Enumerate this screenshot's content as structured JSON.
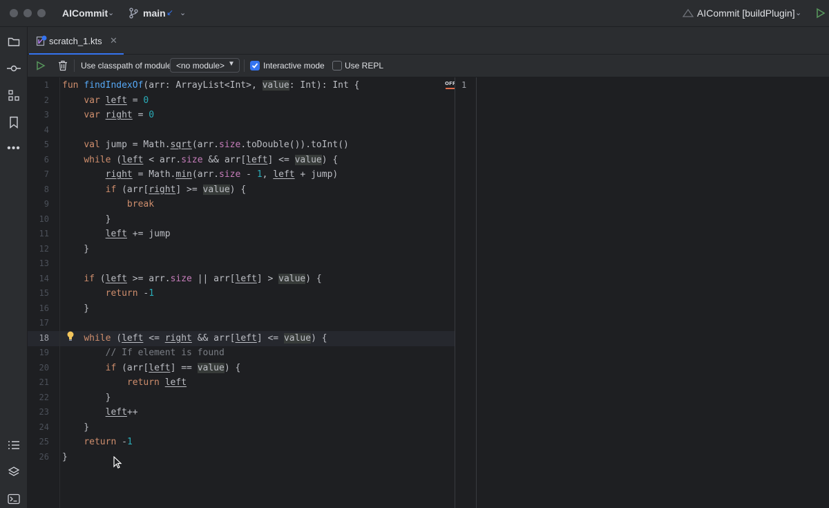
{
  "titlebar": {
    "project_name": "AICommit",
    "branch": "main",
    "run_config": "AICommit [buildPlugin]"
  },
  "tab": {
    "label": "scratch_1.kts"
  },
  "toolbar": {
    "classpath_label": "Use classpath of module",
    "module_select_value": "<no module>",
    "interactive_mode_label": "Interactive mode",
    "interactive_mode_checked": true,
    "use_repl_label": "Use REPL",
    "use_repl_checked": false
  },
  "editor": {
    "current_line": 18,
    "off_badge": "OFF",
    "result_line": "1",
    "line_numbers": [
      "1",
      "2",
      "3",
      "4",
      "5",
      "6",
      "7",
      "8",
      "9",
      "10",
      "11",
      "12",
      "13",
      "14",
      "15",
      "16",
      "17",
      "18",
      "19",
      "20",
      "21",
      "22",
      "23",
      "24",
      "25",
      "26"
    ],
    "lines": [
      [
        {
          "t": "fun ",
          "c": "kw"
        },
        {
          "t": "findIndexOf",
          "c": "fn"
        },
        {
          "t": "(arr: ArrayList<Int>, "
        },
        {
          "t": "value",
          "c": "hl"
        },
        {
          "t": ": Int): Int {"
        }
      ],
      [
        {
          "t": "    "
        },
        {
          "t": "var ",
          "c": "kw"
        },
        {
          "t": "left",
          "c": "u"
        },
        {
          "t": " = "
        },
        {
          "t": "0",
          "c": "num"
        }
      ],
      [
        {
          "t": "    "
        },
        {
          "t": "var ",
          "c": "kw"
        },
        {
          "t": "right",
          "c": "u"
        },
        {
          "t": " = "
        },
        {
          "t": "0",
          "c": "num"
        }
      ],
      [],
      [
        {
          "t": "    "
        },
        {
          "t": "val ",
          "c": "kw"
        },
        {
          "t": "jump = Math."
        },
        {
          "t": "sqrt",
          "c": "u"
        },
        {
          "t": "(arr."
        },
        {
          "t": "size",
          "c": "prop"
        },
        {
          "t": ".toDouble()).toInt()"
        }
      ],
      [
        {
          "t": "    "
        },
        {
          "t": "while ",
          "c": "kw"
        },
        {
          "t": "("
        },
        {
          "t": "left",
          "c": "u"
        },
        {
          "t": " < arr."
        },
        {
          "t": "size",
          "c": "prop"
        },
        {
          "t": " && arr["
        },
        {
          "t": "left",
          "c": "u"
        },
        {
          "t": "] <= "
        },
        {
          "t": "value",
          "c": "hl"
        },
        {
          "t": ") {"
        }
      ],
      [
        {
          "t": "        "
        },
        {
          "t": "right",
          "c": "u"
        },
        {
          "t": " = Math."
        },
        {
          "t": "min",
          "c": "u"
        },
        {
          "t": "(arr."
        },
        {
          "t": "size",
          "c": "prop"
        },
        {
          "t": " - "
        },
        {
          "t": "1",
          "c": "num"
        },
        {
          "t": ", "
        },
        {
          "t": "left",
          "c": "u"
        },
        {
          "t": " + jump)"
        }
      ],
      [
        {
          "t": "        "
        },
        {
          "t": "if ",
          "c": "kw"
        },
        {
          "t": "(arr["
        },
        {
          "t": "right",
          "c": "u"
        },
        {
          "t": "] >= "
        },
        {
          "t": "value",
          "c": "hl"
        },
        {
          "t": ") {"
        }
      ],
      [
        {
          "t": "            "
        },
        {
          "t": "break",
          "c": "kw"
        }
      ],
      [
        {
          "t": "        }"
        }
      ],
      [
        {
          "t": "        "
        },
        {
          "t": "left",
          "c": "u"
        },
        {
          "t": " += jump"
        }
      ],
      [
        {
          "t": "    }"
        }
      ],
      [],
      [
        {
          "t": "    "
        },
        {
          "t": "if ",
          "c": "kw"
        },
        {
          "t": "("
        },
        {
          "t": "left",
          "c": "u"
        },
        {
          "t": " >= arr."
        },
        {
          "t": "size",
          "c": "prop"
        },
        {
          "t": " || arr["
        },
        {
          "t": "left",
          "c": "u"
        },
        {
          "t": "] > "
        },
        {
          "t": "value",
          "c": "hl"
        },
        {
          "t": ") {"
        }
      ],
      [
        {
          "t": "        "
        },
        {
          "t": "return ",
          "c": "kw"
        },
        {
          "t": "-"
        },
        {
          "t": "1",
          "c": "num"
        }
      ],
      [
        {
          "t": "    }"
        }
      ],
      [],
      [
        {
          "t": "    "
        },
        {
          "t": "while ",
          "c": "kw"
        },
        {
          "t": "("
        },
        {
          "t": "left",
          "c": "u"
        },
        {
          "t": " <= "
        },
        {
          "t": "right",
          "c": "u"
        },
        {
          "t": " && arr["
        },
        {
          "t": "left",
          "c": "u"
        },
        {
          "t": "] <= "
        },
        {
          "t": "value",
          "c": "hl"
        },
        {
          "t": ") {"
        }
      ],
      [
        {
          "t": "        "
        },
        {
          "t": "// If element is found",
          "c": "cmt"
        }
      ],
      [
        {
          "t": "        "
        },
        {
          "t": "if ",
          "c": "kw"
        },
        {
          "t": "(arr["
        },
        {
          "t": "left",
          "c": "u"
        },
        {
          "t": "] == "
        },
        {
          "t": "value",
          "c": "hl"
        },
        {
          "t": ") {"
        }
      ],
      [
        {
          "t": "            "
        },
        {
          "t": "return ",
          "c": "kw"
        },
        {
          "t": "left",
          "c": "u"
        }
      ],
      [
        {
          "t": "        }"
        }
      ],
      [
        {
          "t": "        "
        },
        {
          "t": "left",
          "c": "u"
        },
        {
          "t": "++"
        }
      ],
      [
        {
          "t": "    }"
        }
      ],
      [
        {
          "t": "    "
        },
        {
          "t": "return ",
          "c": "kw"
        },
        {
          "t": "-"
        },
        {
          "t": "1",
          "c": "num"
        }
      ],
      [
        {
          "t": "}"
        }
      ]
    ]
  }
}
